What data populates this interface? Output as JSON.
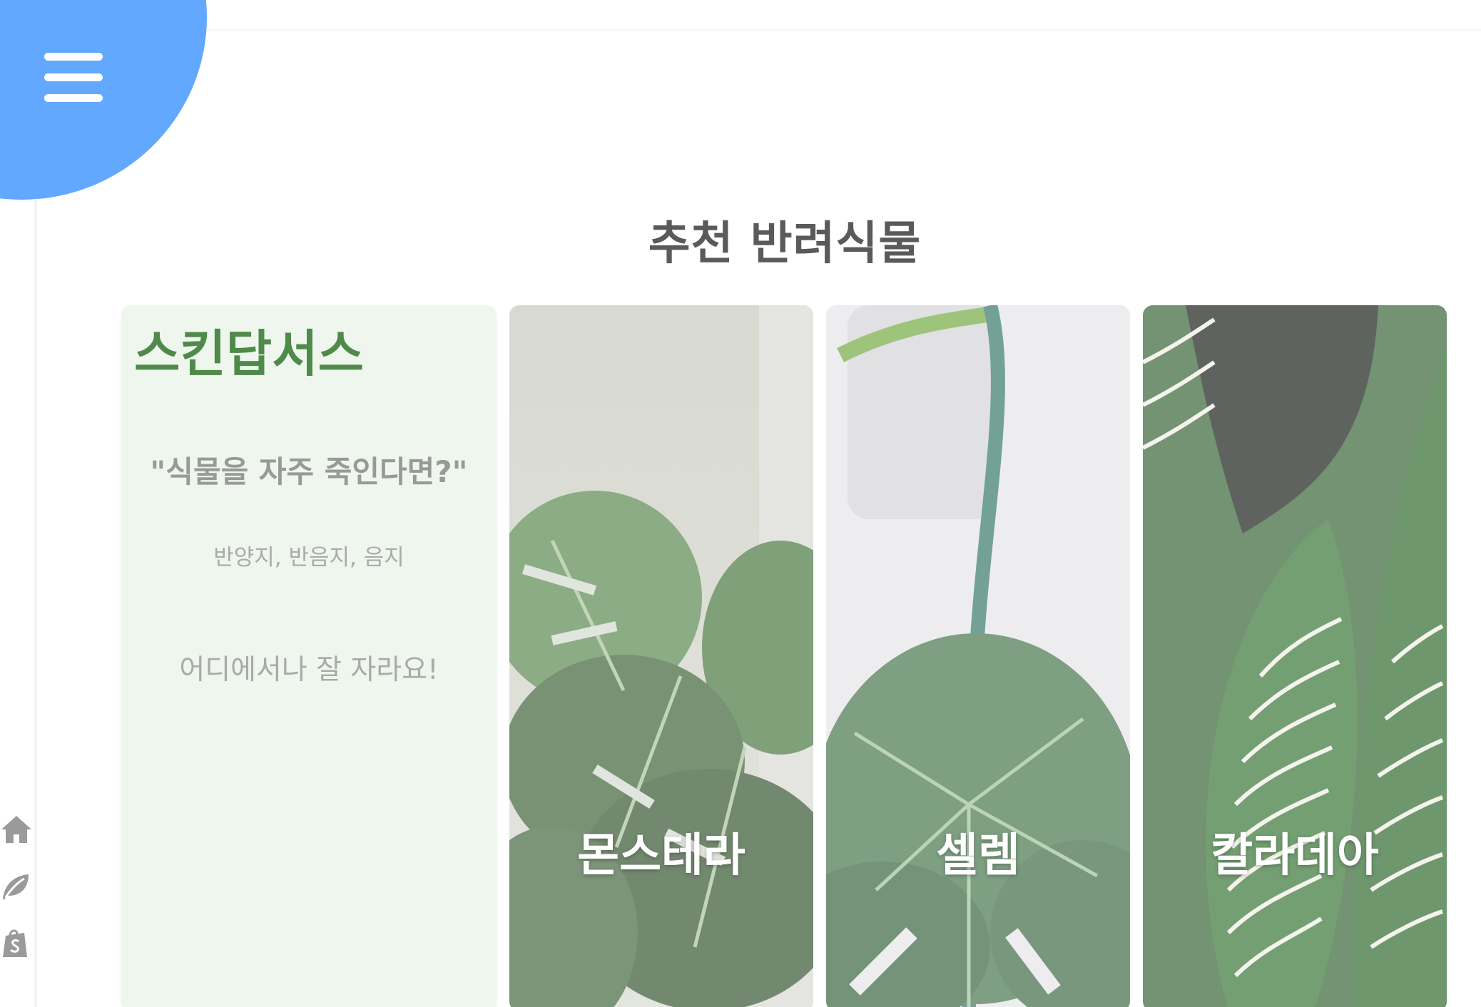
{
  "nav": {
    "menu_icon": "hamburger-menu-icon",
    "accent_color": "#63a8ff",
    "side_icons": [
      "home-icon",
      "leaf-icon",
      "shopify-bag-icon"
    ]
  },
  "section": {
    "title": "추천 반려식물"
  },
  "info_card": {
    "name": "스킨답서스",
    "question": "\"식물을 자주 죽인다면?\"",
    "light": "반양지, 반음지, 음지",
    "description": "어디에서나 잘 자라요!",
    "background_color": "#eef6ee",
    "name_color": "#4f8a4a"
  },
  "plants": [
    {
      "label": "몬스테라",
      "image": "monstera-photo"
    },
    {
      "label": "셀렘",
      "image": "selloum-photo"
    },
    {
      "label": "칼라데아",
      "image": "calathea-photo"
    }
  ]
}
